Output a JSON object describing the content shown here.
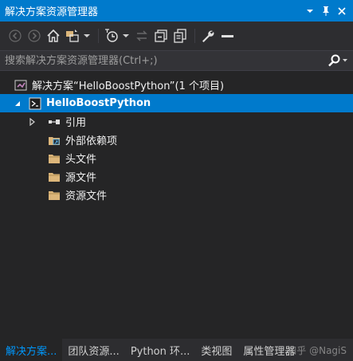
{
  "window": {
    "title": "解决方案资源管理器"
  },
  "titlebar_icons": [
    "dropdown-icon",
    "pin-icon",
    "close-icon"
  ],
  "toolbar_icons": [
    "back-icon",
    "forward-icon",
    "home-icon",
    "switch-views-icon",
    "pending-changes-filter-icon",
    "sync-icon",
    "collapse-all-icon",
    "show-all-files-icon",
    "properties-icon",
    "preview-icon"
  ],
  "search": {
    "placeholder": "搜索解决方案资源管理器(Ctrl+;)",
    "value": ""
  },
  "tree": {
    "solution": {
      "label": "解决方案“HelloBoostPython”(1 个项目)",
      "icon": "solution-icon"
    },
    "project": {
      "label": "HelloBoostPython",
      "icon": "cpp-project-icon",
      "selected": true
    },
    "items": [
      {
        "label": "引用",
        "icon": "references-icon",
        "expandable": true
      },
      {
        "label": "外部依赖项",
        "icon": "external-dependencies-icon",
        "expandable": false
      },
      {
        "label": "头文件",
        "icon": "folder-icon",
        "expandable": false
      },
      {
        "label": "源文件",
        "icon": "folder-icon",
        "expandable": false
      },
      {
        "label": "资源文件",
        "icon": "folder-icon",
        "expandable": false
      }
    ]
  },
  "tabs": [
    {
      "label": "解决方案...",
      "active": true
    },
    {
      "label": "团队资源...",
      "active": false
    },
    {
      "label": "Python 环...",
      "active": false
    },
    {
      "label": "类视图",
      "active": false
    },
    {
      "label": "属性管理器",
      "active": false
    }
  ],
  "watermark": "知乎 @NagiS",
  "colors": {
    "accent": "#007acc",
    "background": "#252526",
    "toolbar": "#2d2d30",
    "active_tab_text": "#0097fb",
    "folder": "#dcb67a"
  }
}
